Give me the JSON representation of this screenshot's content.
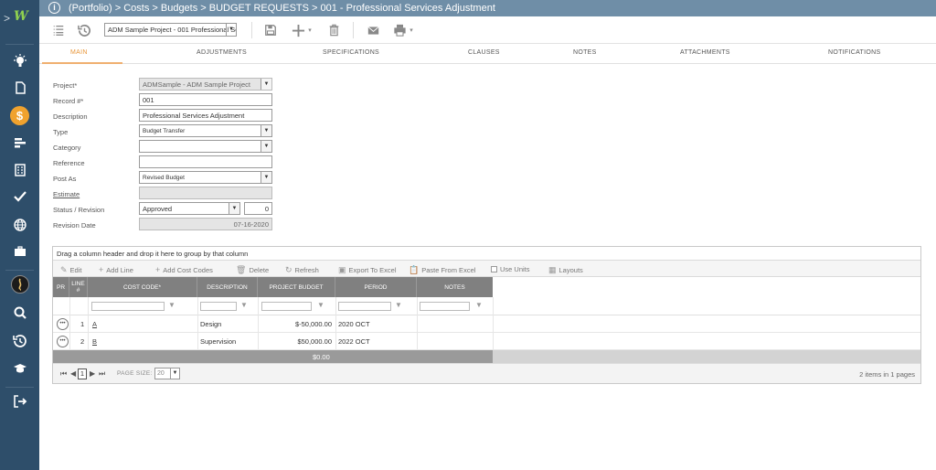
{
  "header": {
    "breadcrumb": "(Portfolio) > Costs > Budgets > BUDGET REQUESTS > 001 - Professional Services Adjustment"
  },
  "toolbar": {
    "project_select": "ADM Sample Project - 001 Professional Services Adjustment"
  },
  "tabs": [
    {
      "label": "MAIN",
      "active": true
    },
    {
      "label": "ADJUSTMENTS"
    },
    {
      "label": "SPECIFICATIONS"
    },
    {
      "label": "CLAUSES"
    },
    {
      "label": "NOTES"
    },
    {
      "label": "ATTACHMENTS"
    },
    {
      "label": "NOTIFICATIONS"
    }
  ],
  "form": {
    "project": {
      "label": "Project*",
      "value": "ADMSample - ADM Sample Project"
    },
    "record": {
      "label": "Record #*",
      "value": "001"
    },
    "description": {
      "label": "Description",
      "value": "Professional Services Adjustment"
    },
    "type": {
      "label": "Type",
      "value": "Budget Transfer"
    },
    "category": {
      "label": "Category",
      "value": ""
    },
    "reference": {
      "label": "Reference",
      "value": ""
    },
    "post_as": {
      "label": "Post As",
      "value": "Revised Budget"
    },
    "estimate": {
      "label": "Estimate",
      "value": ""
    },
    "status": {
      "label": "Status / Revision",
      "value": "Approved",
      "revision": "0"
    },
    "revision_date": {
      "label": "Revision Date",
      "value": "07-16-2020"
    }
  },
  "grid": {
    "group_hint": "Drag a column header and drop it here to group by that column",
    "tools": {
      "edit": "Edit",
      "add_line": "Add Line",
      "add_cost_codes": "Add Cost Codes",
      "delete": "Delete",
      "refresh": "Refresh",
      "export": "Export To Excel",
      "paste": "Paste From Excel",
      "use_units": "Use Units",
      "layouts": "Layouts"
    },
    "columns": {
      "pr": "PR",
      "line_1": "LINE",
      "line_2": "#",
      "cost_code": "COST CODE*",
      "description": "DESCRIPTION",
      "budget": "PROJECT BUDGET",
      "period": "PERIOD",
      "notes": "NOTES"
    },
    "rows": [
      {
        "line": "1",
        "cost_code": "A",
        "description": "Design",
        "budget": "$-50,000.00",
        "period": "2020 OCT",
        "notes": ""
      },
      {
        "line": "2",
        "cost_code": "B",
        "description": "Supervision",
        "budget": "$50,000.00",
        "period": "2022 OCT",
        "notes": ""
      }
    ],
    "total": "$0.00",
    "pager": {
      "page": "1",
      "page_size_label": "PAGE SIZE:",
      "page_size": "20",
      "info": "2 items in 1 pages"
    }
  }
}
